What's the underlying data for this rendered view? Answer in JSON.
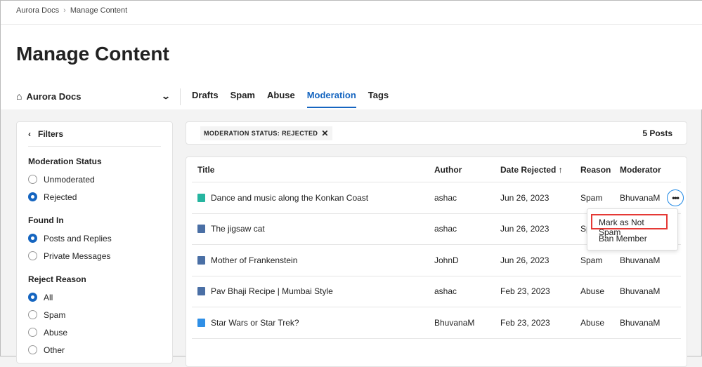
{
  "breadcrumb": [
    "Aurora Docs",
    "Manage Content"
  ],
  "page_title": "Manage Content",
  "community_selector": "Aurora Docs",
  "tabs": [
    {
      "label": "Drafts"
    },
    {
      "label": "Spam"
    },
    {
      "label": "Abuse"
    },
    {
      "label": "Moderation",
      "active": true
    },
    {
      "label": "Tags"
    }
  ],
  "filters": {
    "title": "Filters",
    "groups": [
      {
        "title": "Moderation Status",
        "options": [
          {
            "label": "Unmoderated",
            "checked": false
          },
          {
            "label": "Rejected",
            "checked": true
          }
        ]
      },
      {
        "title": "Found In",
        "options": [
          {
            "label": "Posts and Replies",
            "checked": true
          },
          {
            "label": "Private Messages",
            "checked": false
          }
        ]
      },
      {
        "title": "Reject Reason",
        "options": [
          {
            "label": "All",
            "checked": true
          },
          {
            "label": "Spam",
            "checked": false
          },
          {
            "label": "Abuse",
            "checked": false
          },
          {
            "label": "Other",
            "checked": false
          }
        ]
      }
    ]
  },
  "chip": "MODERATION STATUS: REJECTED",
  "post_count": "5 Posts",
  "table": {
    "headers": [
      "Title",
      "Author",
      "Date Rejected ↑",
      "Reason",
      "Moderator"
    ],
    "rows": [
      {
        "icon": "article-icon",
        "title": "Dance and music along the Konkan Coast",
        "author": "ashac",
        "date": "Jun 26, 2023",
        "reason": "Spam",
        "moderator": "BhuvanaM"
      },
      {
        "icon": "blog-icon",
        "title": "The jigsaw cat",
        "author": "ashac",
        "date": "Jun 26, 2023",
        "reason": "Spam",
        "moderator": "BhuvanaM"
      },
      {
        "icon": "blog-icon",
        "title": "Mother of Frankenstein",
        "author": "JohnD",
        "date": "Jun 26, 2023",
        "reason": "Spam",
        "moderator": "BhuvanaM"
      },
      {
        "icon": "blog-icon",
        "title": "Pav Bhaji Recipe | Mumbai Style",
        "author": "ashac",
        "date": "Feb 23, 2023",
        "reason": "Abuse",
        "moderator": "BhuvanaM"
      },
      {
        "icon": "forum-icon",
        "title": "Star Wars or Star Trek?",
        "author": "BhuvanaM",
        "date": "Feb 23, 2023",
        "reason": "Abuse",
        "moderator": "BhuvanaM"
      }
    ]
  },
  "menu": [
    "Mark as Not Spam",
    "Ban Member"
  ],
  "colors": {
    "accent": "#1565c0",
    "article": "#26b5a0",
    "blog": "#4a6fa5",
    "forum": "#2f8fe6",
    "highlight": "#e53935"
  }
}
